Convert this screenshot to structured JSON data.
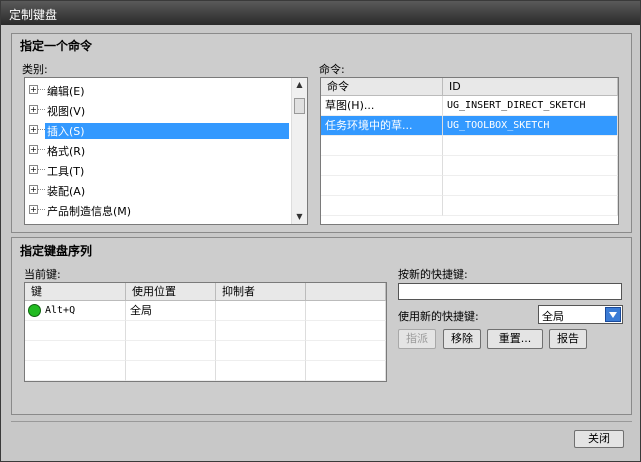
{
  "window": {
    "title": "定制键盘"
  },
  "specify_command": {
    "title": "指定一个命令",
    "category_label": "类别:",
    "categories": [
      {
        "label": "编辑(E)",
        "selected": false
      },
      {
        "label": "视图(V)",
        "selected": false
      },
      {
        "label": "插入(S)",
        "selected": true
      },
      {
        "label": "格式(R)",
        "selected": false
      },
      {
        "label": "工具(T)",
        "selected": false
      },
      {
        "label": "装配(A)",
        "selected": false
      },
      {
        "label": "产品制造信息(M)",
        "selected": false
      }
    ],
    "command_label": "命令:",
    "command_columns": [
      "命令",
      "ID"
    ],
    "commands": [
      {
        "name": "草图(H)...",
        "id": "UG_INSERT_DIRECT_SKETCH",
        "selected": false
      },
      {
        "name": "任务环境中的草...",
        "id": "UG_TOOLBOX_SKETCH",
        "selected": true
      }
    ]
  },
  "keyboard_sequence": {
    "title": "指定键盘序列",
    "current_keys_label": "当前键:",
    "columns": [
      "键",
      "使用位置",
      "抑制者"
    ],
    "rows": [
      {
        "key": "Alt+Q",
        "location": "全局",
        "suppressed_by": ""
      }
    ],
    "new_shortcut_label": "按新的快捷键:",
    "new_shortcut_value": "",
    "use_new_shortcut_label": "使用新的快捷键:",
    "use_new_shortcut_value": "全局",
    "buttons": {
      "assign": "指派",
      "remove": "移除",
      "reset": "重置...",
      "report": "报告"
    }
  },
  "footer": {
    "close": "关闭"
  }
}
